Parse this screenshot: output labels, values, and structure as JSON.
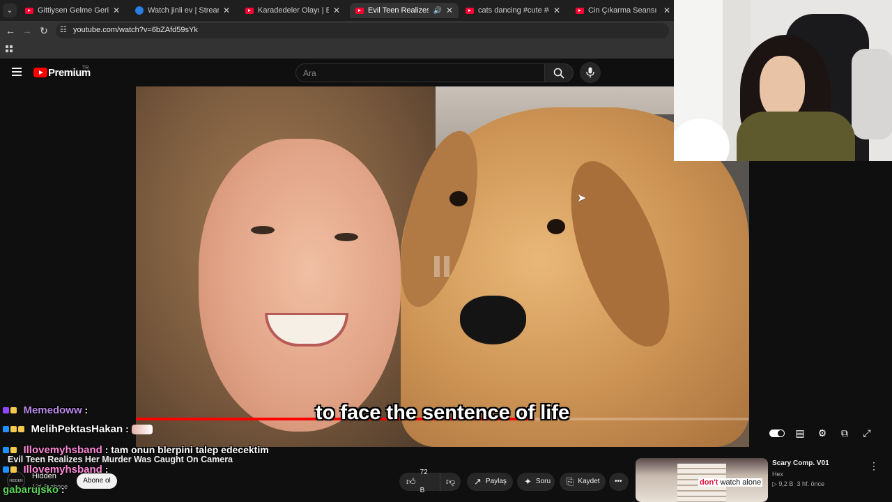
{
  "browser": {
    "tabs": [
      {
        "title": "Gittiysen Gelme Geri Kedi Versi",
        "icon": "youtube-icon",
        "active": false
      },
      {
        "title": "Watch jinli ev | Streamable",
        "icon": "streamable-icon",
        "active": false
      },
      {
        "title": "Karadedeler Olayı | Eski Türk Fi",
        "icon": "youtube-icon",
        "active": false
      },
      {
        "title": "Evil Teen Realizes Her Murd",
        "icon": "youtube-icon",
        "active": true
      },
      {
        "title": "cats dancing #cute #cats #danc",
        "icon": "youtube-icon",
        "active": false
      },
      {
        "title": "Cin Çıkarma Seansı Remix! - Yo",
        "icon": "youtube-icon",
        "active": false
      }
    ],
    "url": "youtube.com/watch?v=6bZAfd59sYk"
  },
  "youtube": {
    "logo_text": "Premium",
    "region": "TR",
    "search_placeholder": "Ara"
  },
  "video": {
    "subtitle": "to face the sentence of life",
    "progress": 0.65,
    "title": "Evil Teen Realizes Her Murder Was Caught On Camera",
    "channel_name": "Hidden",
    "channel_avatar_text": "HIDDEN",
    "subscribers": "131 B abone",
    "subscribe_label": "Abone ol",
    "like_count": "72 B",
    "share_label": "Paylaş",
    "ask_label": "Soru",
    "save_label": "Kaydet"
  },
  "chat": [
    {
      "user": "Memedoww",
      "color": "#b98be8",
      "message": ""
    },
    {
      "user": "MelihPektasHakan",
      "color": "#ffffff",
      "message": ""
    },
    {
      "user": "Illovemyhsband",
      "color": "#ff8ad8",
      "message": "tam onun blerpini talep edecektim"
    },
    {
      "user": "Illovemyhsband",
      "color": "#ff8ad8",
      "message": ""
    },
    {
      "user": "gabarujsko",
      "color": "#5bd45b",
      "message": ""
    }
  ],
  "recommendation": {
    "title": "Scary Comp. V01",
    "channel": "Hex",
    "views": "▷ 9,2 B",
    "age": "3 hf. önce",
    "thumb_caption_red": "don't",
    "thumb_caption": " watch alone"
  },
  "colors": {
    "youtube_red": "#ff0000",
    "background": "#0f0f0f"
  }
}
